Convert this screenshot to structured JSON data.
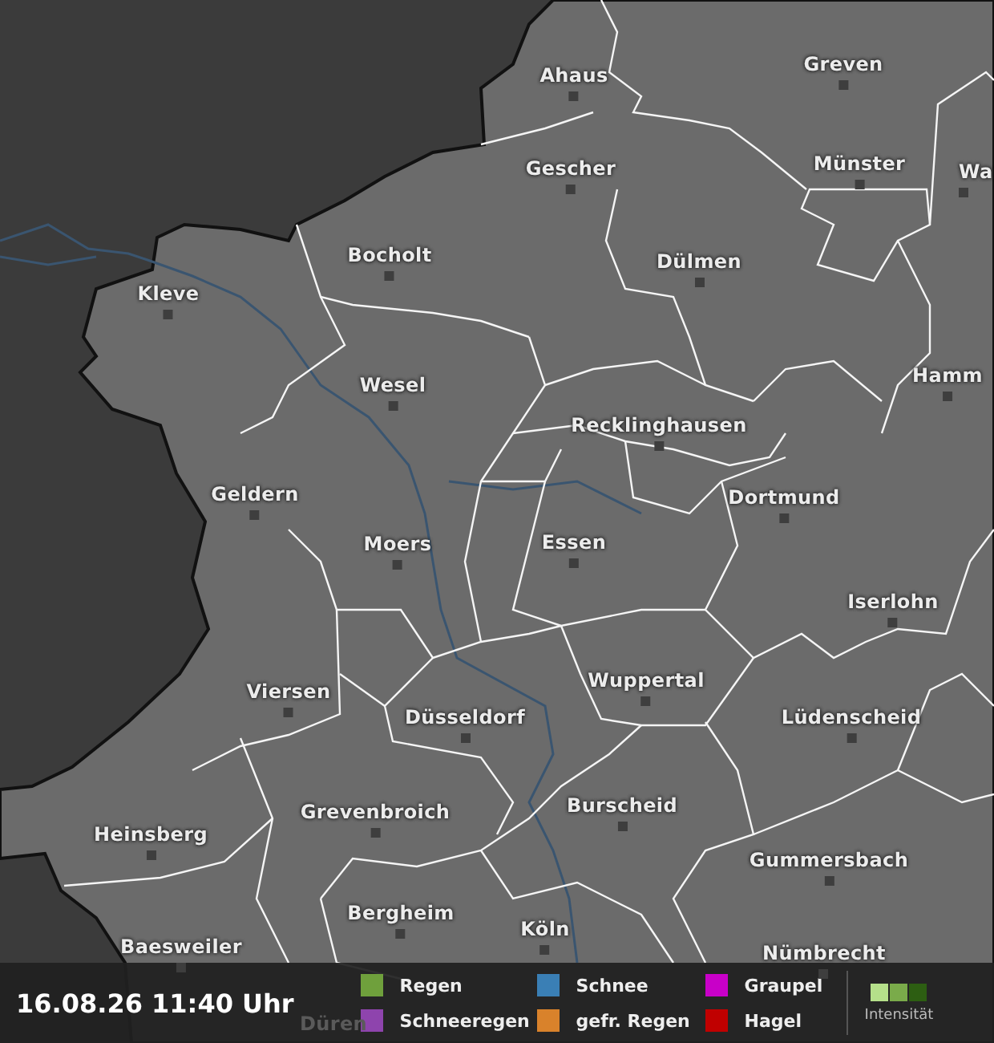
{
  "map": {
    "cities": [
      {
        "name": "Ahaus"
      },
      {
        "name": "Greven"
      },
      {
        "name": "Gescher"
      },
      {
        "name": "Münster"
      },
      {
        "name": "Wa"
      },
      {
        "name": "Bocholt"
      },
      {
        "name": "Dülmen"
      },
      {
        "name": "Kleve"
      },
      {
        "name": "Wesel"
      },
      {
        "name": "Hamm"
      },
      {
        "name": "Recklinghausen"
      },
      {
        "name": "Geldern"
      },
      {
        "name": "Dortmund"
      },
      {
        "name": "Moers"
      },
      {
        "name": "Essen"
      },
      {
        "name": "Iserlohn"
      },
      {
        "name": "Viersen"
      },
      {
        "name": "Wuppertal"
      },
      {
        "name": "Düsseldorf"
      },
      {
        "name": "Lüdenscheid"
      },
      {
        "name": "Grevenbroich"
      },
      {
        "name": "Burscheid"
      },
      {
        "name": "Heinsberg"
      },
      {
        "name": "Gummersbach"
      },
      {
        "name": "Bergheim"
      },
      {
        "name": "Köln"
      },
      {
        "name": "Baesweiler"
      },
      {
        "name": "Nümbrecht"
      },
      {
        "name": "Düren"
      }
    ]
  },
  "footer": {
    "timestamp": "16.08.26 11:40 Uhr",
    "legend": [
      {
        "label": "Regen",
        "color": "#6fa03c"
      },
      {
        "label": "Schneeregen",
        "color": "#8e44ad"
      },
      {
        "label": "Schnee",
        "color": "#3a7fb5"
      },
      {
        "label": "gefr. Regen",
        "color": "#d9822b"
      },
      {
        "label": "Graupel",
        "color": "#c800c8"
      },
      {
        "label": "Hagel",
        "color": "#c00000"
      }
    ],
    "intensity": {
      "label": "Intensität",
      "scale": [
        {
          "color": "#b5e08a"
        },
        {
          "color": "#7aab4a"
        },
        {
          "color": "#2d5e12"
        }
      ]
    }
  }
}
